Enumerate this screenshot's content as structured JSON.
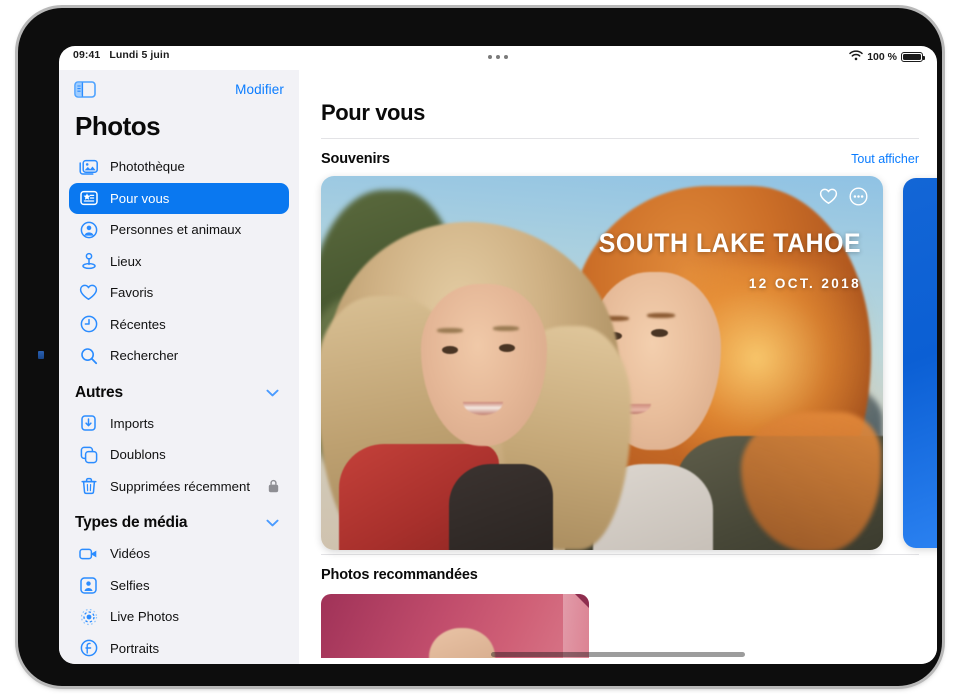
{
  "status_bar": {
    "time": "09:41",
    "date": "Lundi 5 juin",
    "wifi_icon": "wifi-icon",
    "battery_percent": "100 %",
    "multitask_dots_icon": "multitasking-dots-icon"
  },
  "sidebar": {
    "toggle_icon": "sidebar-toggle-icon",
    "edit_label": "Modifier",
    "title": "Photos",
    "primary_items": [
      {
        "label": "Photothèque",
        "icon": "photo-library-icon",
        "selected": false
      },
      {
        "label": "Pour vous",
        "icon": "for-you-icon",
        "selected": true
      },
      {
        "label": "Personnes et animaux",
        "icon": "people-pets-icon",
        "selected": false
      },
      {
        "label": "Lieux",
        "icon": "places-pin-icon",
        "selected": false
      },
      {
        "label": "Favoris",
        "icon": "heart-icon",
        "selected": false
      },
      {
        "label": "Récentes",
        "icon": "clock-icon",
        "selected": false
      },
      {
        "label": "Rechercher",
        "icon": "search-icon",
        "selected": false
      }
    ],
    "sections": [
      {
        "header": "Autres",
        "chevron_icon": "chevron-down-icon",
        "items": [
          {
            "label": "Imports",
            "icon": "import-tray-icon",
            "trailing_icon": ""
          },
          {
            "label": "Doublons",
            "icon": "duplicates-icon",
            "trailing_icon": ""
          },
          {
            "label": "Supprimées récemment",
            "icon": "trash-icon",
            "trailing_icon": "lock-icon"
          }
        ]
      },
      {
        "header": "Types de média",
        "chevron_icon": "chevron-down-icon",
        "items": [
          {
            "label": "Vidéos",
            "icon": "video-camera-icon",
            "trailing_icon": ""
          },
          {
            "label": "Selfies",
            "icon": "selfie-icon",
            "trailing_icon": ""
          },
          {
            "label": "Live Photos",
            "icon": "live-photo-icon",
            "trailing_icon": ""
          },
          {
            "label": "Portraits",
            "icon": "portrait-f-icon",
            "trailing_icon": ""
          }
        ]
      }
    ]
  },
  "main": {
    "page_title": "Pour vous",
    "memories_section": {
      "title": "Souvenirs",
      "see_all_label": "Tout afficher"
    },
    "memory_card": {
      "title": "SOUTH LAKE TAHOE",
      "date": "12 OCT. 2018",
      "favorite_icon": "heart-outline-icon",
      "more_icon": "ellipsis-circle-icon"
    },
    "recommended_section": {
      "title": "Photos recommandées"
    }
  },
  "colors": {
    "accent_blue": "#0a7cff",
    "selected_row": "#0a78f0",
    "sidebar_bg": "#f2f2f6",
    "text_primary": "#0a0a0a",
    "divider": "#e3e3e6"
  }
}
